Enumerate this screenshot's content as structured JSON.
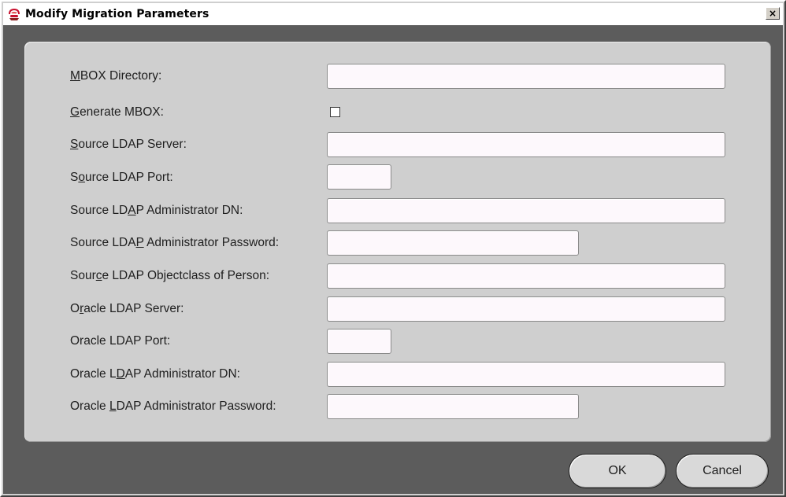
{
  "window": {
    "title": "Modify Migration Parameters",
    "close_label": "×",
    "icon": "oracle-java-app-icon"
  },
  "form": {
    "fields": [
      {
        "pre": "",
        "mn": "M",
        "post": "BOX Directory:",
        "type": "text",
        "value": ""
      },
      {
        "pre": "",
        "mn": "G",
        "post": "enerate MBOX:",
        "type": "checkbox",
        "checked": false
      },
      {
        "pre": "",
        "mn": "S",
        "post": "ource LDAP Server:",
        "type": "text",
        "value": ""
      },
      {
        "pre": "S",
        "mn": "o",
        "post": "urce LDAP Port:",
        "type": "text",
        "value": ""
      },
      {
        "pre": "Source LD",
        "mn": "A",
        "post": "P Administrator DN:",
        "type": "text",
        "value": ""
      },
      {
        "pre": "Source LDA",
        "mn": "P",
        "post": " Administrator Password:",
        "type": "password",
        "value": ""
      },
      {
        "pre": "Sour",
        "mn": "c",
        "post": "e LDAP Objectclass of Person:",
        "type": "text",
        "value": ""
      },
      {
        "pre": "O",
        "mn": "r",
        "post": "acle LDAP Server:",
        "type": "text",
        "value": ""
      },
      {
        "pre": "Oracle LDAP Port:",
        "mn": "",
        "post": "",
        "type": "text",
        "value": ""
      },
      {
        "pre": "Oracle L",
        "mn": "D",
        "post": "AP Administrator DN:",
        "type": "text",
        "value": ""
      },
      {
        "pre": "Oracle ",
        "mn": "L",
        "post": "DAP Administrator Password:",
        "type": "password",
        "value": ""
      }
    ]
  },
  "buttons": {
    "ok_label": "OK",
    "cancel_label": "Cancel"
  },
  "colors": {
    "title_bar": "#ffffff",
    "frame": "#5c5c5c",
    "panel": "#cfcfcf",
    "field_bg": "#fdf8fc"
  }
}
